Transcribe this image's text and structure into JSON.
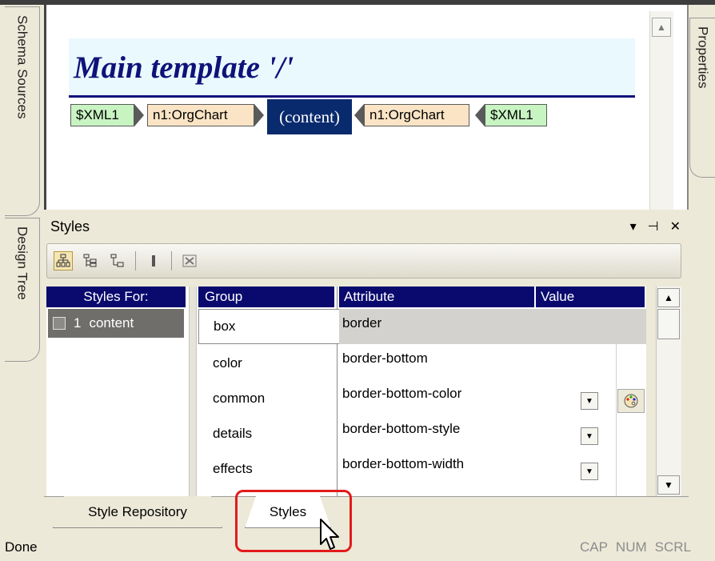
{
  "side_tabs": {
    "schema_sources": "Schema Sources",
    "design_tree": "Design Tree",
    "properties": "Properties"
  },
  "design": {
    "title": "Main template '/'",
    "tags": [
      "$XML1",
      "n1:OrgChart",
      "(content)",
      "n1:OrgChart",
      "$XML1"
    ]
  },
  "styles_panel": {
    "title": "Styles",
    "controls": [
      "▾",
      "⊣",
      "✕"
    ],
    "styles_for": {
      "header": "Styles For:",
      "row_index": "1",
      "row_label": "content"
    },
    "group": {
      "header": "Group",
      "items": [
        "box",
        "color",
        "common",
        "details",
        "effects"
      ]
    },
    "attribute": {
      "header": "Attribute",
      "items": [
        "border",
        "border-bottom",
        "border-bottom-color",
        "border-bottom-style",
        "border-bottom-width"
      ]
    },
    "value": {
      "header": "Value"
    }
  },
  "bottom_tabs": {
    "style_repository": "Style Repository",
    "styles": "Styles"
  },
  "status_bar": {
    "left": "Done",
    "indicators": [
      "CAP",
      "NUM",
      "SCRL"
    ]
  },
  "colors": {
    "header_bg": "#0a0a6e",
    "title_text": "#10127a",
    "xml_tag": "#c8f4c2",
    "element_tag": "#fbe4c5",
    "highlight": "#e21b1b"
  }
}
